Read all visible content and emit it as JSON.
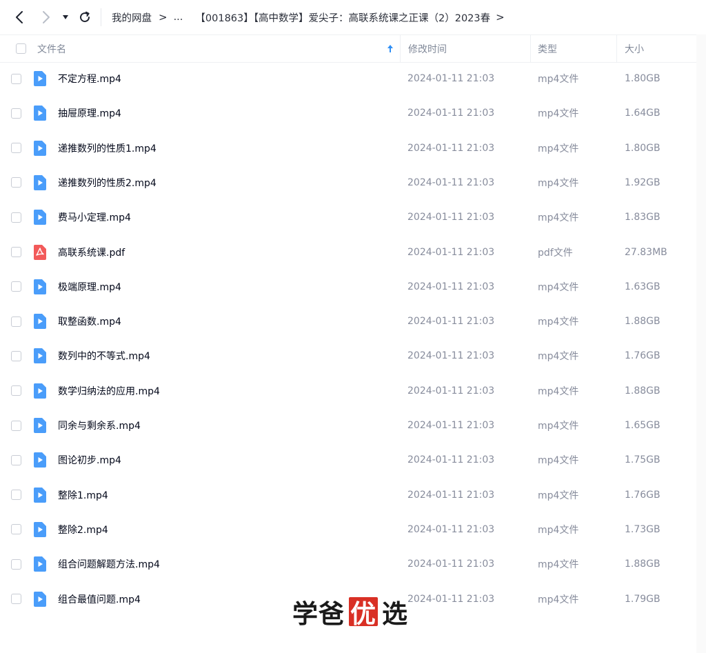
{
  "breadcrumb": {
    "root": "我的网盘",
    "separator": ">",
    "ellipsis": "...",
    "folder": "【001863】【高中数学】爱尖子：高联系统课之正课（2）2023春",
    "end": ">"
  },
  "header": {
    "name": "文件名",
    "time": "修改时间",
    "type": "类型",
    "size": "大小"
  },
  "colors": {
    "video_icon": "#4a9dfa",
    "pdf_icon": "#f25a5a",
    "sort_arrow": "#2f8ff5",
    "watermark_box": "#d93025"
  },
  "files": [
    {
      "name": "不定方程.mp4",
      "time": "2024-01-11 21:03",
      "type": "mp4文件",
      "size": "1.80GB",
      "icon": "video-icon"
    },
    {
      "name": "抽屉原理.mp4",
      "time": "2024-01-11 21:03",
      "type": "mp4文件",
      "size": "1.64GB",
      "icon": "video-icon"
    },
    {
      "name": "递推数列的性质1.mp4",
      "time": "2024-01-11 21:03",
      "type": "mp4文件",
      "size": "1.80GB",
      "icon": "video-icon"
    },
    {
      "name": "递推数列的性质2.mp4",
      "time": "2024-01-11 21:03",
      "type": "mp4文件",
      "size": "1.92GB",
      "icon": "video-icon"
    },
    {
      "name": "费马小定理.mp4",
      "time": "2024-01-11 21:03",
      "type": "mp4文件",
      "size": "1.83GB",
      "icon": "video-icon"
    },
    {
      "name": "高联系统课.pdf",
      "time": "2024-01-11 21:03",
      "type": "pdf文件",
      "size": "27.83MB",
      "icon": "pdf-icon"
    },
    {
      "name": "极端原理.mp4",
      "time": "2024-01-11 21:03",
      "type": "mp4文件",
      "size": "1.63GB",
      "icon": "video-icon"
    },
    {
      "name": "取整函数.mp4",
      "time": "2024-01-11 21:03",
      "type": "mp4文件",
      "size": "1.88GB",
      "icon": "video-icon"
    },
    {
      "name": "数列中的不等式.mp4",
      "time": "2024-01-11 21:03",
      "type": "mp4文件",
      "size": "1.76GB",
      "icon": "video-icon"
    },
    {
      "name": "数学归纳法的应用.mp4",
      "time": "2024-01-11 21:03",
      "type": "mp4文件",
      "size": "1.88GB",
      "icon": "video-icon"
    },
    {
      "name": "同余与剩余系.mp4",
      "time": "2024-01-11 21:03",
      "type": "mp4文件",
      "size": "1.65GB",
      "icon": "video-icon"
    },
    {
      "name": "图论初步.mp4",
      "time": "2024-01-11 21:03",
      "type": "mp4文件",
      "size": "1.75GB",
      "icon": "video-icon"
    },
    {
      "name": "整除1.mp4",
      "time": "2024-01-11 21:03",
      "type": "mp4文件",
      "size": "1.76GB",
      "icon": "video-icon"
    },
    {
      "name": "整除2.mp4",
      "time": "2024-01-11 21:03",
      "type": "mp4文件",
      "size": "1.73GB",
      "icon": "video-icon"
    },
    {
      "name": "组合问题解题方法.mp4",
      "time": "2024-01-11 21:03",
      "type": "mp4文件",
      "size": "1.88GB",
      "icon": "video-icon"
    },
    {
      "name": "组合最值问题.mp4",
      "time": "2024-01-11 21:03",
      "type": "mp4文件",
      "size": "1.79GB",
      "icon": "video-icon"
    }
  ],
  "watermark": {
    "char1": "学",
    "char2": "爸",
    "char3": "优",
    "char4": "选"
  }
}
